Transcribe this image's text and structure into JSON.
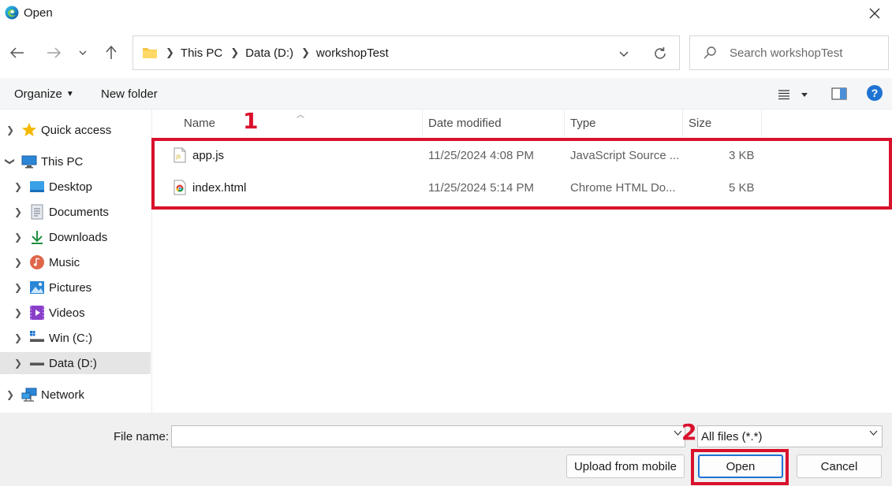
{
  "window": {
    "title": "Open",
    "app_icon": "edge-icon",
    "close_icon": "close-icon"
  },
  "nav": {
    "back_icon": "arrow-left-icon",
    "forward_icon": "arrow-right-icon",
    "recent_icon": "chevron-down-icon",
    "up_icon": "arrow-up-icon",
    "breadcrumbs": [
      "This PC",
      "Data (D:)",
      "workshopTest"
    ],
    "search_placeholder": "Search workshopTest"
  },
  "toolbar": {
    "organize_label": "Organize",
    "new_folder_label": "New folder",
    "help_label": "?"
  },
  "sidebar": {
    "items": [
      {
        "label": "Quick access",
        "icon": "star-icon"
      },
      {
        "label": "This PC",
        "icon": "computer-icon"
      },
      {
        "label": "Desktop",
        "icon": "desktop-icon"
      },
      {
        "label": "Documents",
        "icon": "documents-icon"
      },
      {
        "label": "Downloads",
        "icon": "download-icon"
      },
      {
        "label": "Music",
        "icon": "music-icon"
      },
      {
        "label": "Pictures",
        "icon": "pictures-icon"
      },
      {
        "label": "Videos",
        "icon": "videos-icon"
      },
      {
        "label": "Win (C:)",
        "icon": "drive-icon"
      },
      {
        "label": "Data (D:)",
        "icon": "drive-icon"
      },
      {
        "label": "Network",
        "icon": "network-icon"
      }
    ],
    "selected": "Data (D:)"
  },
  "files": {
    "columns": [
      "Name",
      "Date modified",
      "Type",
      "Size"
    ],
    "rows": [
      {
        "name": "app.js",
        "date": "11/25/2024 4:08 PM",
        "type": "JavaScript Source ...",
        "size": "3 KB",
        "icon": "js-file-icon"
      },
      {
        "name": "index.html",
        "date": "11/25/2024 5:14 PM",
        "type": "Chrome HTML Do...",
        "size": "5 KB",
        "icon": "chrome-html-file-icon"
      }
    ]
  },
  "annotations": {
    "step1": "1",
    "step2": "2",
    "color": "#d9112c"
  },
  "bottom": {
    "file_name_label": "File name:",
    "file_name_value": "",
    "file_type": "All files (*.*)",
    "upload_label": "Upload from mobile",
    "open_label": "Open",
    "cancel_label": "Cancel"
  },
  "colors": {
    "accent": "#1e73d2",
    "selected_bg": "#e5e5e5"
  }
}
